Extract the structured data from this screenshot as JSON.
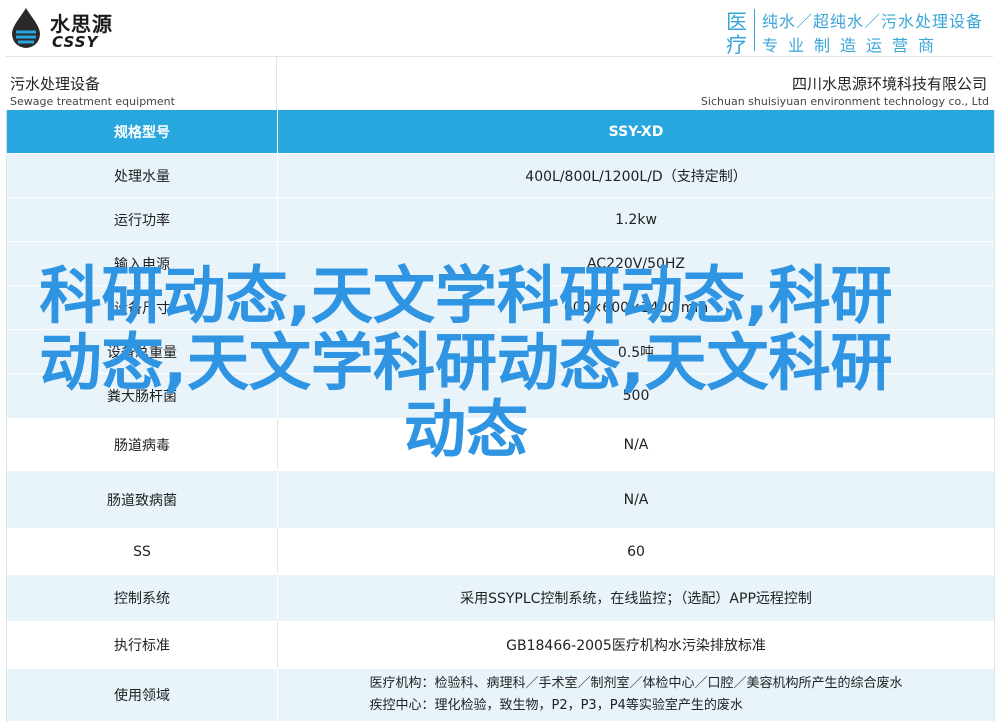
{
  "header": {
    "logo_cn": "水思源",
    "logo_en": "CSSY",
    "badge_char1": "医",
    "badge_char2": "疗",
    "badge_line1": "纯水／超纯水／污水处理设备",
    "badge_line2": "专业制造运营商"
  },
  "subheader": {
    "left_cn": "污水处理设备",
    "left_en": "Sewage treatment equipment",
    "right_cn": "四川水思源环境科技有限公司",
    "right_en": "Sichuan shuisiyuan environment technology co., Ltd"
  },
  "table": {
    "header": {
      "label": "规格型号",
      "value": "SSY-XD"
    },
    "rows": [
      {
        "label": "处理水量",
        "value": "400L/800L/1200L/D（支持定制）"
      },
      {
        "label": "运行功率",
        "value": "1.2kw"
      },
      {
        "label": "输入电源",
        "value": "AC220V/50HZ"
      },
      {
        "label": "设备尺寸",
        "value": "600×600×1400 mm"
      },
      {
        "label": "设备总重量",
        "value": "0.5吨"
      },
      {
        "label": "粪大肠杆菌",
        "value": "500"
      },
      {
        "label": "肠道病毒",
        "value": "N/A"
      },
      {
        "label": "肠道致病菌",
        "value": "N/A"
      },
      {
        "label": "SS",
        "value": "60"
      },
      {
        "label": "控制系统",
        "value": "采用SSYPLC控制系统，在线监控；（选配）APP远程控制"
      },
      {
        "label": "执行标准",
        "value": "GB18466-2005医疗机构水污染排放标准"
      },
      {
        "label": "使用领域",
        "value_line1": "医疗机构：检验科、病理科／手术室／制剂室／体检中心／口腔／美容机构所产生的综合废水",
        "value_line2": "疾控中心：理化检验，致生物，P2，P3，P4等实验室产生的废水"
      }
    ]
  },
  "overlay_text": "科研动态,天文学科研动态,科研动态,天文学科研动态,天文科研动态"
}
